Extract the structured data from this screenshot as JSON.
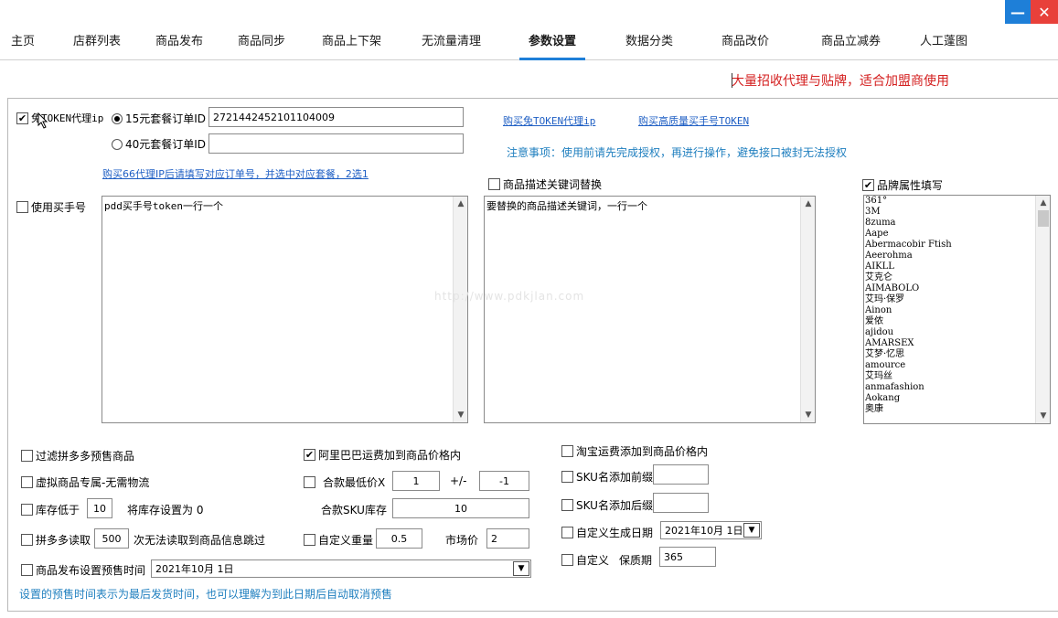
{
  "window": {
    "minimize_glyph": "—",
    "close_glyph": "✕"
  },
  "tabs": [
    {
      "label": "主页"
    },
    {
      "label": "店群列表"
    },
    {
      "label": "商品发布"
    },
    {
      "label": "商品同步"
    },
    {
      "label": "商品上下架"
    },
    {
      "label": "无流量清理"
    },
    {
      "label": "参数设置",
      "active": true
    },
    {
      "label": "数据分类"
    },
    {
      "label": "商品改价"
    },
    {
      "label": "商品立减券"
    },
    {
      "label": "人工蓬图"
    }
  ],
  "marquee_text": "大量招收代理与贴牌，适合加盟商使用",
  "proxy": {
    "free_token_label": "免TOKEN代理ip",
    "free_token_checked": true,
    "radio_15_label": "15元套餐订单ID",
    "radio_15_value": "2721442452101104009",
    "radio_40_label": "40元套餐订单ID",
    "radio_40_value": "",
    "link_buy_proxy": "购买免TOKEN代理ip",
    "link_buy_token": "购买高质量买手号TOKEN",
    "notice": "注意事项：使用前请先完成授权，再进行操作，避免接口被封无法授权",
    "link_buy66": "购买66代理IP后请填写对应订单号，并选中对应套餐，2选1"
  },
  "buyer": {
    "label": "使用买手号",
    "checked": false,
    "textarea": "pdd买手号token一行一个"
  },
  "keyword": {
    "label": "商品描述关键词替换",
    "checked": false,
    "textarea": "要替换的商品描述关键词，一行一个"
  },
  "brand": {
    "label": "品牌属性填写",
    "checked": true,
    "items": [
      "361°",
      "3M",
      "8zuma",
      "Aape",
      "Abermacobir Ftish",
      "Aeerohma",
      "AIKLL",
      "艾克仑",
      "AIMABOLO",
      "艾玛·保罗",
      "Ainon",
      "爱侬",
      "ajidou",
      "AMARSEX",
      "艾梦·忆思",
      "amource",
      "艾玛丝",
      "anmafashion",
      "Aokang",
      "奥康"
    ]
  },
  "watermark": "http://www.pdkjlan.com",
  "options_left": {
    "filter_presale": {
      "label": "过滤拼多多预售商品",
      "checked": false
    },
    "virtual": {
      "label": "虚拟商品专属-无需物流",
      "checked": false
    },
    "stock_low_label": "库存低于",
    "stock_low_value": "10",
    "stock_set_label": "将库存设置为 0",
    "stock_low_checked": false,
    "pdd_read_label": "拼多多读取",
    "pdd_read_value": "500",
    "pdd_read_suffix": "次无法读取到商品信息跳过",
    "pdd_read_checked": false,
    "presale_time_label": "商品发布设置预售时间",
    "presale_time_value": "2021年10月 1日",
    "presale_time_checked": false
  },
  "options_mid": {
    "ali_freight": {
      "label": "阿里巴巴运费加到商品价格内",
      "checked": true
    },
    "min_price_label": "合款最低价X",
    "min_price_value": "1",
    "plusminus": "+/-",
    "plusminus_value": "-1",
    "min_price_checked": false,
    "sku_stock_label": "合款SKU库存",
    "sku_stock_value": "10",
    "weight_label": "自定义重量",
    "weight_value": "0.5",
    "weight_checked": false,
    "market_price_label": "市场价",
    "market_price_value": "2"
  },
  "options_right": {
    "taobao_freight": {
      "label": "淘宝运费添加到商品价格内",
      "checked": false
    },
    "sku_prefix_label": "SKU名添加前缀",
    "sku_prefix_value": "",
    "sku_prefix_checked": false,
    "sku_suffix_label": "SKU名添加后缀",
    "sku_suffix_value": "",
    "sku_suffix_checked": false,
    "custom_date_label": "自定义生成日期",
    "custom_date_value": "2021年10月 1日",
    "custom_date_checked": false,
    "custom_label": "自定义",
    "shelf_life_label": "保质期",
    "shelf_life_value": "365",
    "custom_checked": false
  },
  "footer_note": "设置的预售时间表示为最后发货时间，也可以理解为到此日期后自动取消预售",
  "colors": {
    "accent": "#1e7fd8",
    "close": "#e8403a",
    "marquee": "#d42020",
    "link": "#1f5fc4",
    "note": "#1f7fbf"
  }
}
